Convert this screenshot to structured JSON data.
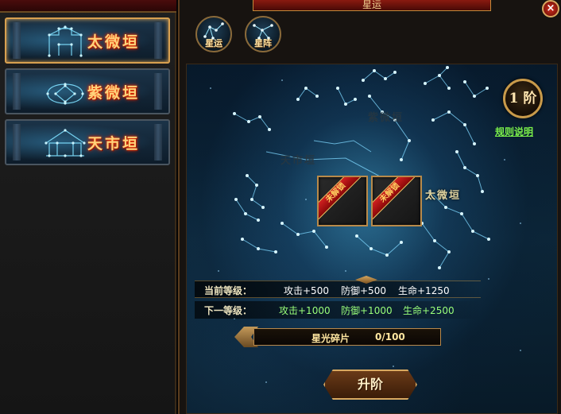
{
  "window": {
    "title": "星运"
  },
  "constellation_tabs": [
    {
      "label": "太微垣",
      "icon": "gate-constellation-icon",
      "active": true
    },
    {
      "label": "紫微垣",
      "icon": "palace-constellation-icon",
      "active": false
    },
    {
      "label": "天市垣",
      "icon": "market-constellation-icon",
      "active": false
    }
  ],
  "top_tabs": [
    {
      "label": "星运",
      "icon": "star-fortune-icon"
    },
    {
      "label": "星阵",
      "icon": "star-array-icon"
    }
  ],
  "tier_badge": {
    "label": "1 阶"
  },
  "rules_link": {
    "label": "规则说明"
  },
  "map_labels": {
    "ziwei": "紫微垣",
    "tianshi": "天市垣",
    "taiwei": "太微垣"
  },
  "slots": [
    {
      "ribbon": "未解锁"
    },
    {
      "ribbon": "未解锁"
    }
  ],
  "stats": {
    "current": {
      "label": "当前等级：",
      "attack": "攻击+500",
      "defense": "防御+500",
      "hp": "生命+1250"
    },
    "next": {
      "label": "下一等级：",
      "attack": "攻击+1000",
      "defense": "防御+1000",
      "hp": "生命+2500"
    }
  },
  "progress": {
    "label": "星光碎片",
    "value_text": "0/100",
    "fraction": 0
  },
  "upgrade_button": {
    "label": "升阶"
  },
  "close_button": {
    "label": "×"
  },
  "colors": {
    "accent_gold": "#d8a860",
    "tab_label": "#ffd27a",
    "next_level_green": "#9aff7a",
    "rules_link": "#7aef4a",
    "ribbon_red": "#d02020"
  }
}
